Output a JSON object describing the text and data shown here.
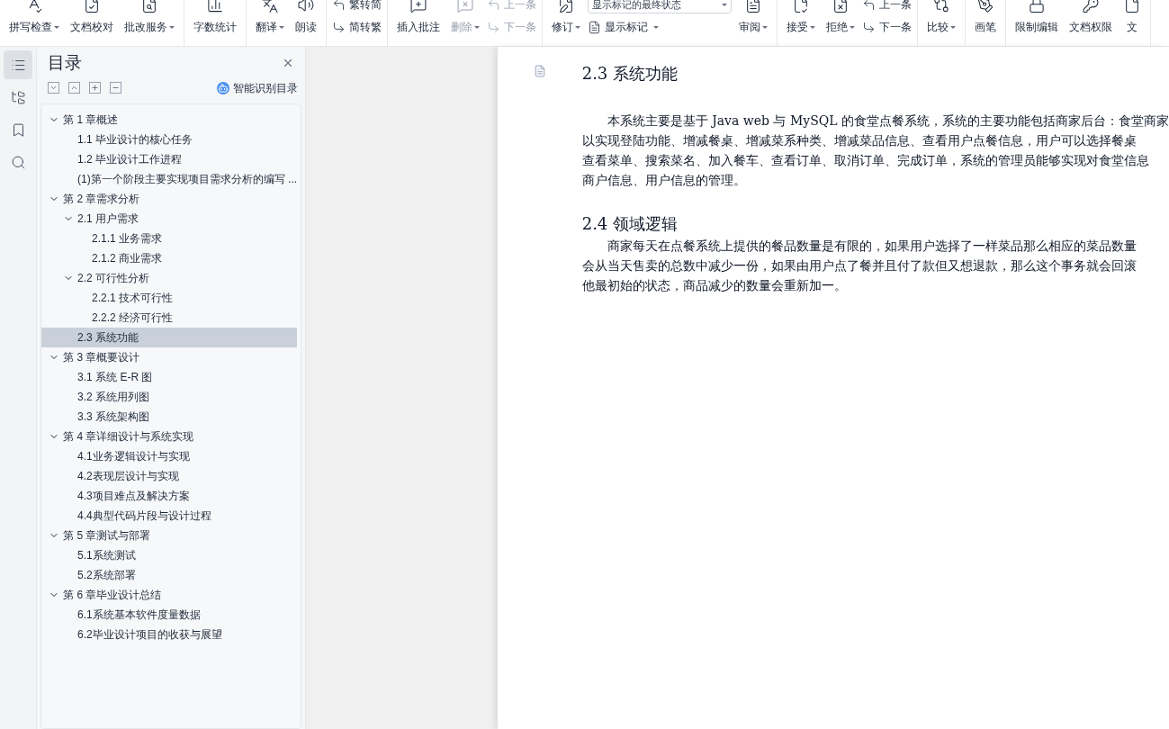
{
  "toolbar": {
    "groups": [
      {
        "items": [
          {
            "kind": "big",
            "label": "拼写检查",
            "dropdown": true,
            "disabled": false
          },
          {
            "kind": "big",
            "label": "文档校对",
            "dropdown": false,
            "disabled": false
          },
          {
            "kind": "big",
            "label": "批改服务",
            "dropdown": true,
            "disabled": false
          }
        ]
      },
      {
        "items": [
          {
            "kind": "big",
            "label": "字数统计",
            "dropdown": false,
            "disabled": false
          }
        ]
      },
      {
        "items": [
          {
            "kind": "big",
            "label": "翻译",
            "dropdown": true,
            "disabled": false
          },
          {
            "kind": "big",
            "label": "朗读",
            "dropdown": false,
            "disabled": false
          }
        ]
      },
      {
        "items": [
          {
            "kind": "stack",
            "entries": [
              {
                "label": "繁转简",
                "disabled": false
              },
              {
                "label": "简转繁",
                "disabled": false
              }
            ]
          }
        ]
      },
      {
        "items": [
          {
            "kind": "big",
            "label": "插入批注",
            "dropdown": false,
            "disabled": false
          },
          {
            "kind": "big",
            "label": "删除",
            "dropdown": true,
            "disabled": true
          },
          {
            "kind": "stack",
            "entries": [
              {
                "label": "上一条",
                "disabled": true
              },
              {
                "label": "下一条",
                "disabled": true
              }
            ]
          }
        ]
      },
      {
        "items": [
          {
            "kind": "big",
            "label": "修订",
            "dropdown": true,
            "disabled": false
          },
          {
            "kind": "select",
            "value": "显示标记的最终状态",
            "label": "显示标记"
          },
          {
            "kind": "big",
            "label": "审阅",
            "dropdown": true,
            "disabled": false
          }
        ]
      },
      {
        "items": [
          {
            "kind": "big",
            "label": "接受",
            "dropdown": true,
            "disabled": false
          },
          {
            "kind": "big",
            "label": "拒绝",
            "dropdown": true,
            "disabled": false
          },
          {
            "kind": "stack",
            "entries": [
              {
                "label": "上一条",
                "disabled": false
              },
              {
                "label": "下一条",
                "disabled": false
              }
            ]
          }
        ]
      },
      {
        "items": [
          {
            "kind": "big",
            "label": "比较",
            "dropdown": true,
            "disabled": false
          }
        ]
      },
      {
        "items": [
          {
            "kind": "big",
            "label": "画笔",
            "dropdown": false,
            "disabled": false
          }
        ]
      },
      {
        "items": [
          {
            "kind": "big",
            "label": "限制编辑",
            "dropdown": false,
            "disabled": false
          },
          {
            "kind": "big",
            "label": "文档权限",
            "dropdown": false,
            "disabled": false
          },
          {
            "kind": "big",
            "label": "文",
            "dropdown": false,
            "disabled": false
          }
        ]
      }
    ]
  },
  "rail": [
    {
      "selected": true
    },
    {
      "selected": false
    },
    {
      "selected": false
    },
    {
      "selected": false
    }
  ],
  "toc_panel": {
    "title": "目录",
    "smart_button": "智能识别目录",
    "items": [
      {
        "label": "第 1 章概述",
        "expanded": true,
        "selected": false,
        "children": [
          {
            "label": "1.1 毕业设计的核心任务",
            "selected": false
          },
          {
            "label": "1.2 毕业设计工作进程",
            "selected": false
          },
          {
            "label": "(1)第一个阶段主要实现项目需求分析的编写 ...",
            "selected": false
          }
        ]
      },
      {
        "label": "第 2 章需求分析",
        "expanded": true,
        "selected": false,
        "children": [
          {
            "label": "2.1 用户需求",
            "expanded": true,
            "selected": false,
            "children": [
              {
                "label": "2.1.1 业务需求",
                "selected": false
              },
              {
                "label": "2.1.2 商业需求",
                "selected": false
              }
            ]
          },
          {
            "label": "2.2 可行性分析",
            "expanded": true,
            "selected": false,
            "children": [
              {
                "label": "2.2.1 技术可行性",
                "selected": false
              },
              {
                "label": "2.2.2 经济可行性",
                "selected": false
              }
            ]
          },
          {
            "label": "2.3 系统功能",
            "selected": true
          }
        ]
      },
      {
        "label": "第 3 章概要设计",
        "expanded": true,
        "selected": false,
        "children": [
          {
            "label": "3.1 系统 E-R 图",
            "selected": false
          },
          {
            "label": "3.2 系统用列图",
            "selected": false
          },
          {
            "label": "3.3 系统架构图",
            "selected": false
          }
        ]
      },
      {
        "label": "第 4 章详细设计与系统实现",
        "expanded": true,
        "selected": false,
        "children": [
          {
            "label": "4.1业务逻辑设计与实现",
            "selected": false
          },
          {
            "label": "4.2表现层设计与实现",
            "selected": false
          },
          {
            "label": "4.3项目难点及解决方案",
            "selected": false
          },
          {
            "label": "4.4典型代码片段与设计过程",
            "selected": false
          }
        ]
      },
      {
        "label": "第 5 章测试与部署",
        "expanded": true,
        "selected": false,
        "children": [
          {
            "label": "5.1系统测试",
            "selected": false
          },
          {
            "label": "5.2系统部署",
            "selected": false
          }
        ]
      },
      {
        "label": "第 6 章毕业设计总结",
        "expanded": true,
        "selected": false,
        "children": [
          {
            "label": "6.1系统基本软件度量数据",
            "selected": false
          },
          {
            "label": "6.2毕业设计项目的收获与展望",
            "selected": false
          }
        ]
      }
    ]
  },
  "document": {
    "sections": [
      {
        "heading": "2.3 系统功能",
        "lines": [
          "本系统主要是基于 Java web 与 MySQL 的食堂点餐系统，系统的主要功能包括商家后台：食堂商家",
          "以实现登陆功能、增减餐桌、增减菜系种类、增减菜品信息、查看用户点餐信息，用户可以选择餐桌",
          "查看菜单、搜索菜名、加入餐车、查看订单、取消订单、完成订单，系统的管理员能够实现对食堂信息",
          "商户信息、用户信息的管理。"
        ]
      },
      {
        "heading": "2.4 领域逻辑",
        "lines": [
          "商家每天在点餐系统上提供的餐品数量是有限的，如果用户选择了一样菜品那么相应的菜品数量",
          "会从当天售卖的总数中减少一份，如果由用户点了餐并且付了款但又想退款，那么这个事务就会回滚",
          "他最初始的状态，商品减少的数量会重新加一。"
        ]
      }
    ]
  }
}
